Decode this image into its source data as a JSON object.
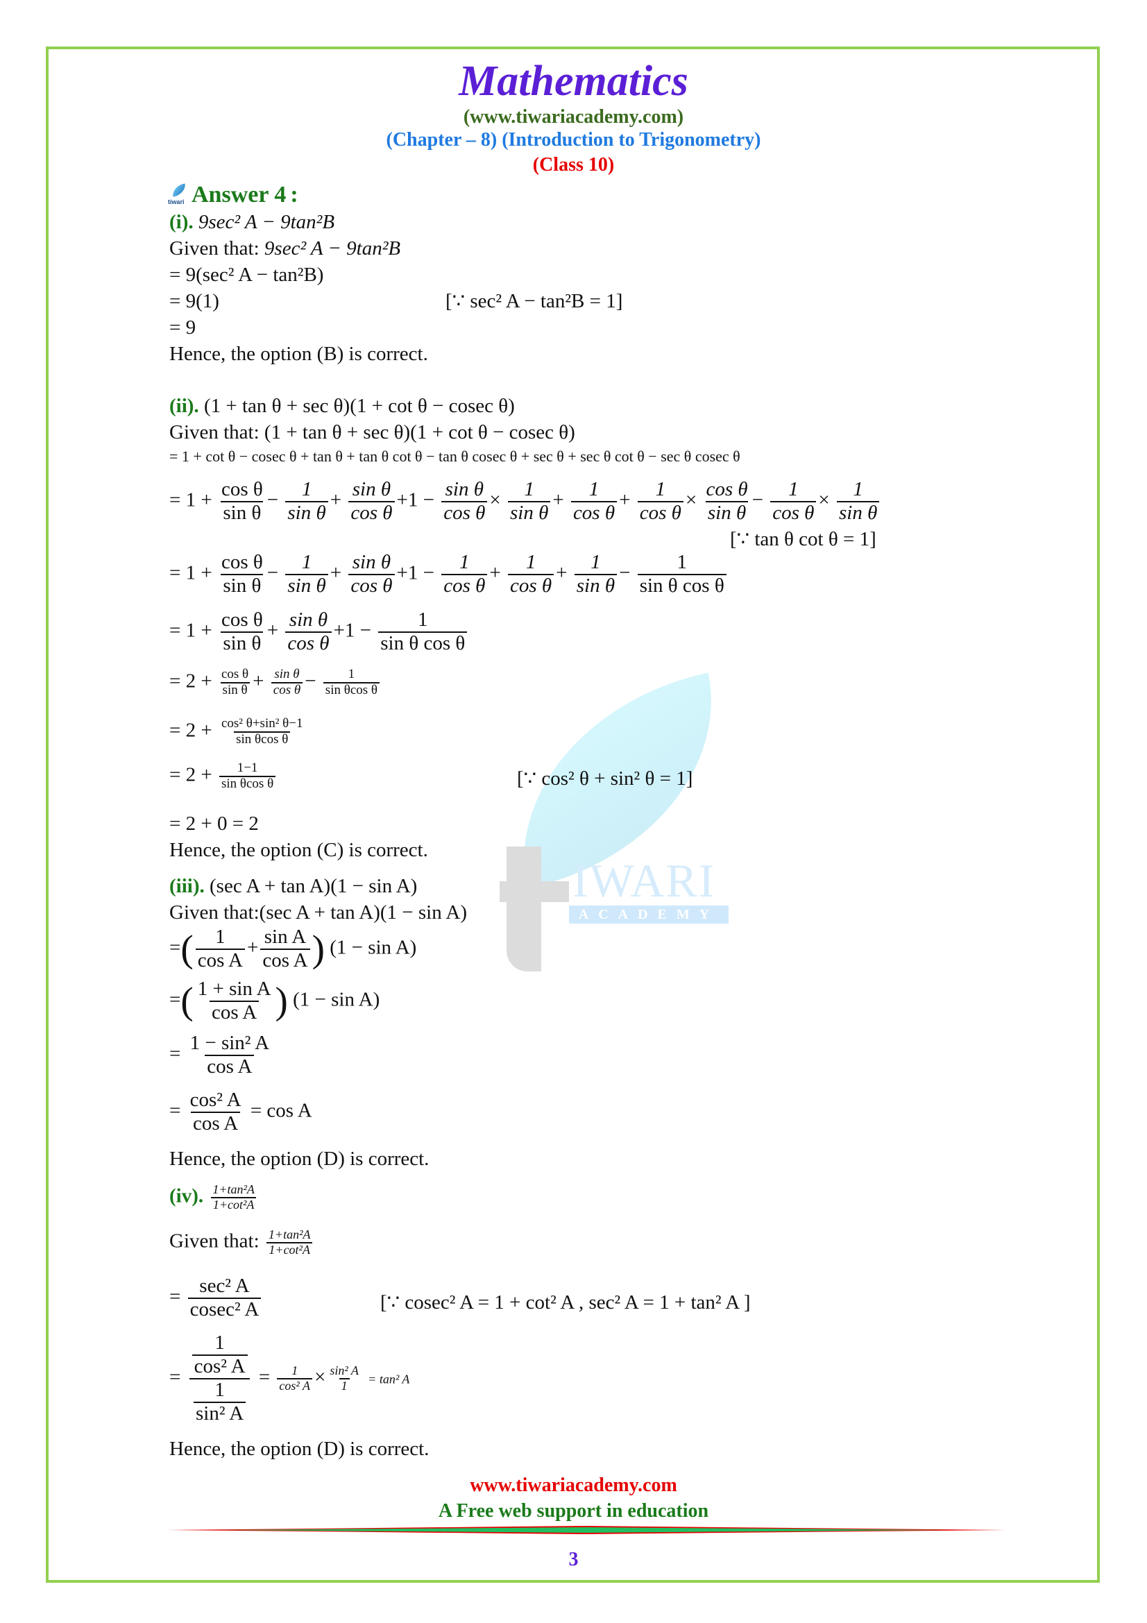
{
  "header": {
    "title": "Mathematics",
    "site": "(www.tiwariacademy.com)",
    "chapter": "(Chapter – 8) (Introduction to Trigonometry)",
    "class": "(Class 10)"
  },
  "answer": {
    "heading": "Answer 4",
    "colon": ":",
    "logo_text": "tiwari"
  },
  "parts": {
    "i": {
      "label": "(i).",
      "question": "9sec² A − 9tan²B",
      "given_prefix": "Given that:",
      "given": "9sec² A − 9tan²B",
      "step1": "= 9(sec² A − tan²B)",
      "step2": "= 9(1)",
      "reason": "[∵  sec² A − tan²B = 1]",
      "step3": "= 9",
      "conclusion": "Hence, the option (B) is correct."
    },
    "ii": {
      "label": "(ii).",
      "question": "(1 + tan θ + sec θ)(1 + cot θ − cosec θ)",
      "given_prefix": "Given that:",
      "given": "(1 + tan θ + sec θ)(1 + cot θ − cosec θ)",
      "expand": "= 1 + cot θ − cosec θ + tan θ + tan θ cot θ − tan θ cosec θ + sec θ + sec θ cot θ − sec θ cosec θ",
      "reason1": "[∵  tan θ cot θ = 1]",
      "step_final1": "= 2 + 0 = 2",
      "reason2": "[∵  cos² θ + sin² θ = 1]",
      "conclusion": "Hence, the option (C) is correct."
    },
    "iii": {
      "label": "(iii).",
      "question": "(sec A + tan A)(1 − sin A)",
      "given_prefix": "Given that:",
      "given": "(sec A + tan A)(1 − sin A)",
      "conclusion": "Hence, the option (D) is correct."
    },
    "iv": {
      "label": "(iv).",
      "num": "1+tan²A",
      "den": "1+cot²A",
      "given_prefix": "Given that:",
      "reason": "[∵  cosec² A = 1 + cot² A ,  sec² A = 1 + tan² A ]",
      "conclusion": "Hence, the option (D) is correct."
    }
  },
  "frac": {
    "cos_t": "cos θ",
    "sin_t": "sin θ",
    "one": "1",
    "sin_cos": "sin θ cos θ",
    "sin_cos2": "sin θcos θ",
    "num_c2s2": "cos² θ+sin² θ−1",
    "one_minus_one": "1−1",
    "one_p_sinA": "1 + sin A",
    "cosA": "cos A",
    "sinA": "sin A",
    "one_m_sin2A": "1 − sin² A",
    "cos2A": "cos² A",
    "sec2A": "sec² A",
    "cosec2A": "cosec² A",
    "sin2A": "sin² A"
  },
  "tokens": {
    "eq1": "= 1 +",
    "eq2": "= 2 +",
    "minus": "−",
    "plus": "+",
    "times": "×",
    "plus1minus": "+1 −",
    "one_minus_sinA": "(1 − sin A)",
    "eq": "=",
    "eq_cosA": "= cos A",
    "eq_tan2A": "= tan² A",
    "lp": "(",
    "rp": ")"
  },
  "watermark": {
    "word": "IWARI",
    "sub": "ACADEMY"
  },
  "footer": {
    "site": "www.tiwariacademy.com",
    "tagline": "A Free web support in education",
    "page_number": "3"
  }
}
